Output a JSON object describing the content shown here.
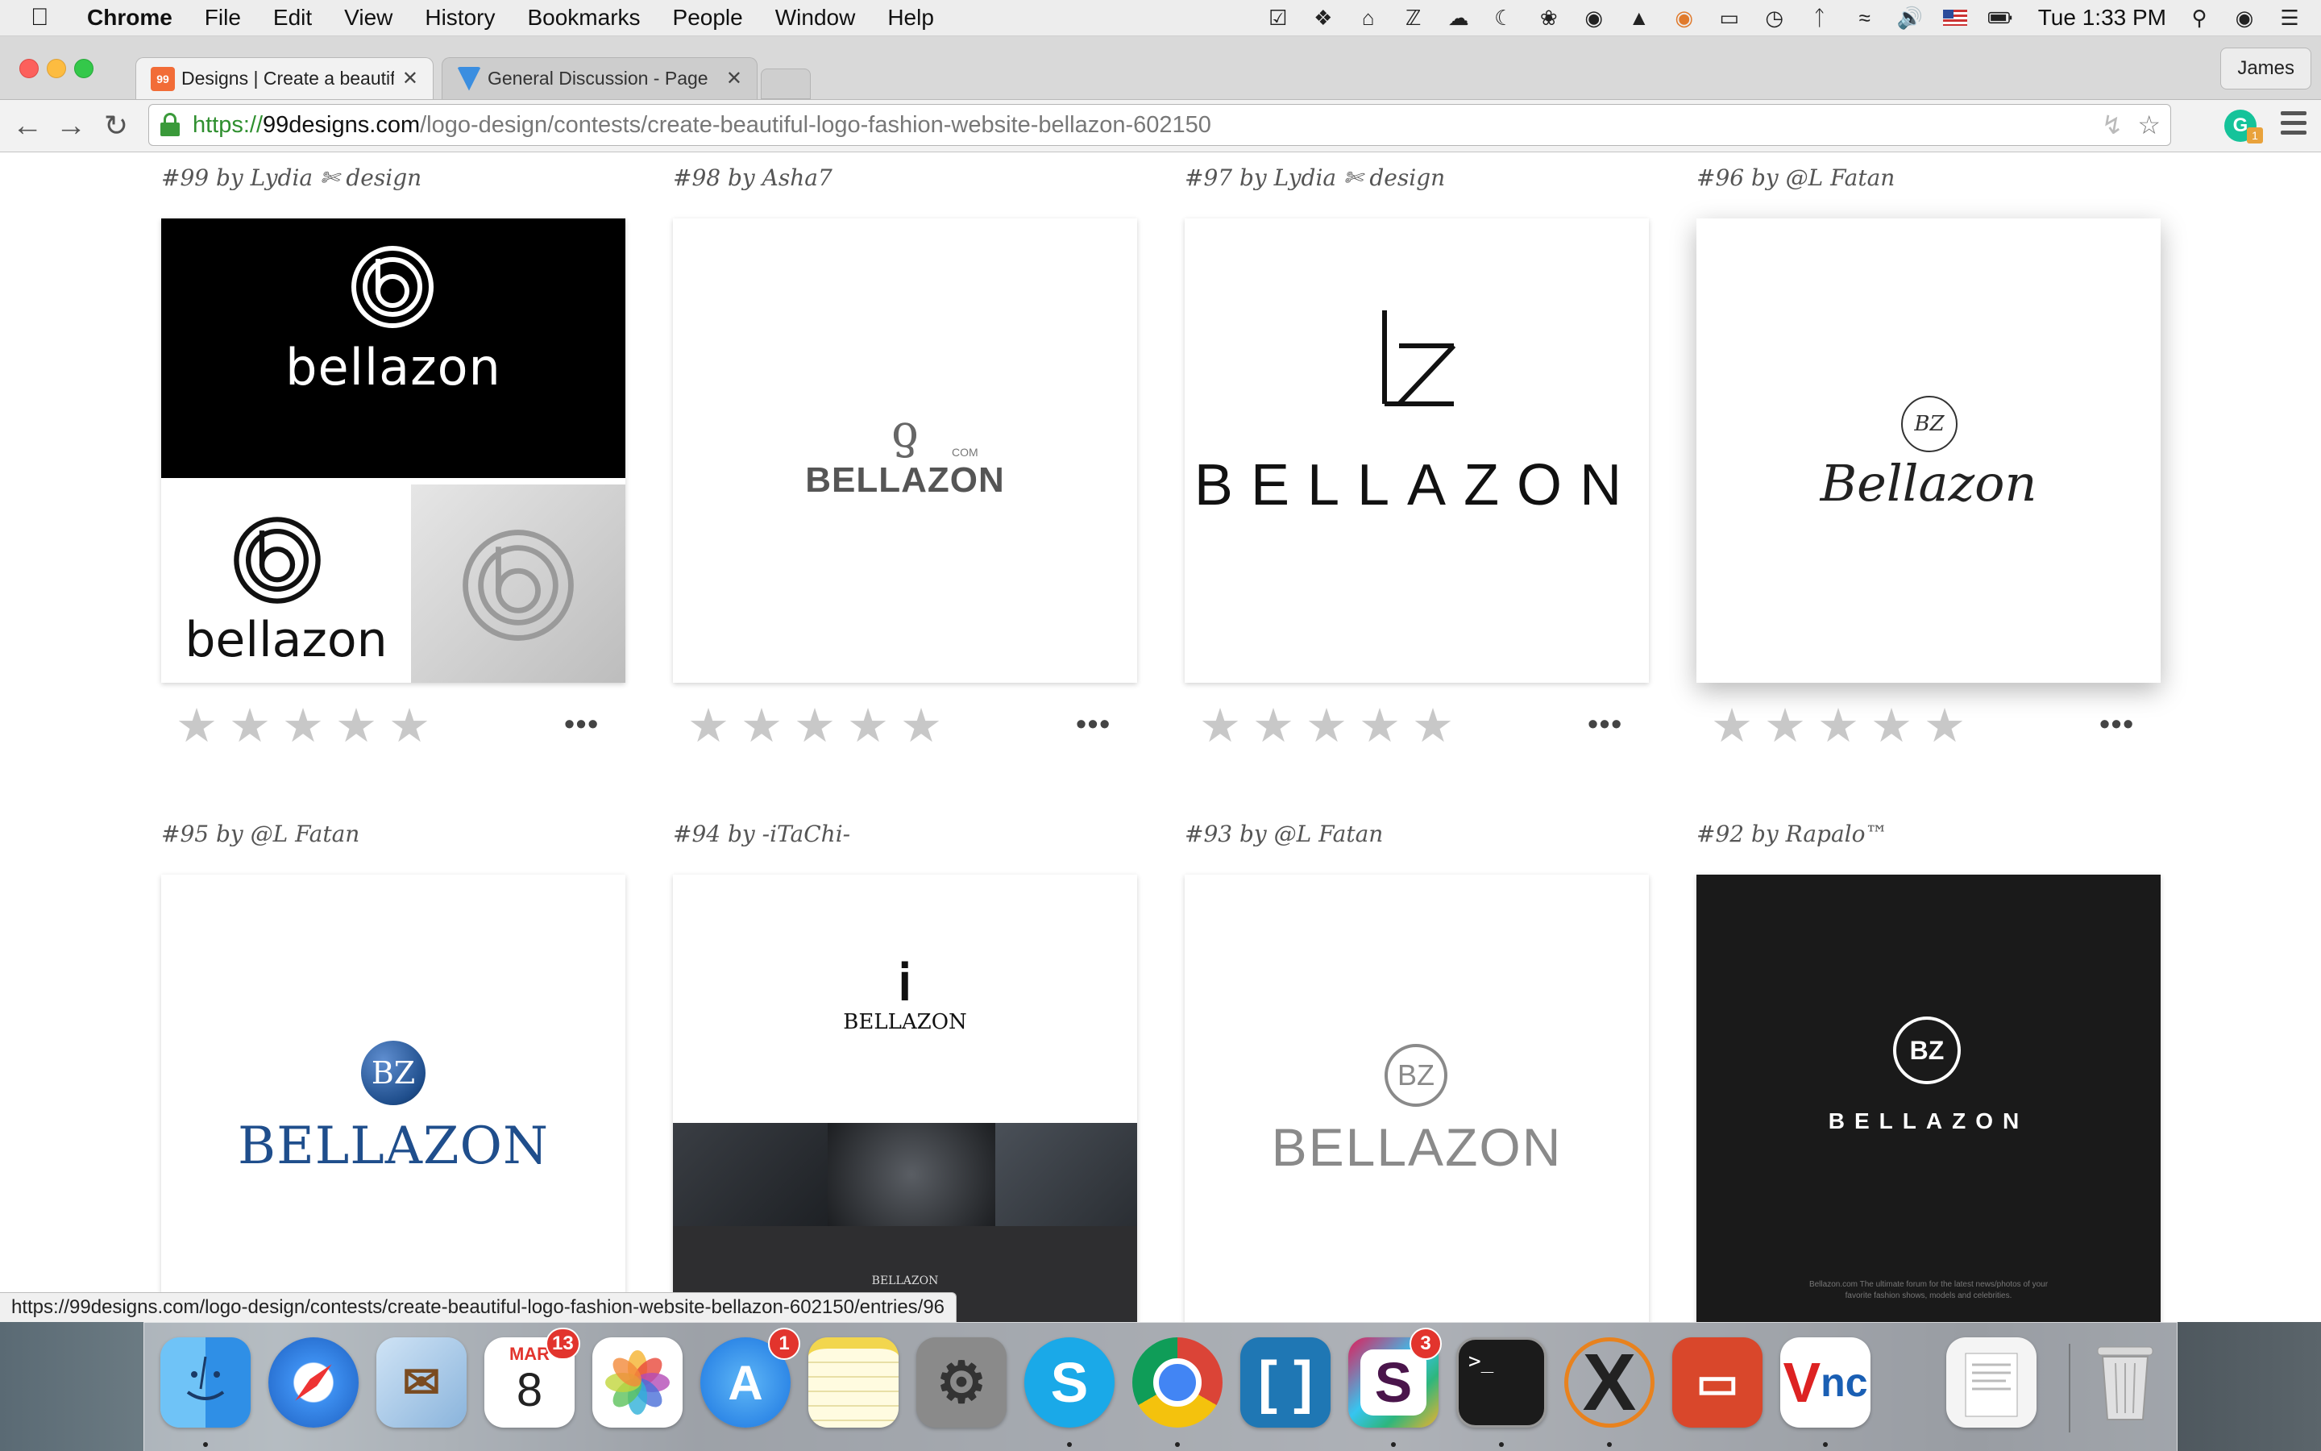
{
  "menubar": {
    "app": "Chrome",
    "items": [
      "File",
      "Edit",
      "View",
      "History",
      "Bookmarks",
      "People",
      "Window",
      "Help"
    ],
    "clock": "Tue 1:33 PM"
  },
  "tabs": [
    {
      "title": "Designs | Create a beautiful",
      "favicon": "99"
    },
    {
      "title": "General Discussion - Page"
    }
  ],
  "profile": "James",
  "address": {
    "scheme": "https://",
    "host": "99designs.com",
    "path": "/logo-design/contests/create-beautiful-logo-fashion-website-bellazon-602150"
  },
  "entries": [
    {
      "label": "#99 by Lydia ✄ design",
      "logo": "bellazon",
      "sub": "bellazon"
    },
    {
      "label": "#98 by Asha7",
      "logo": "BELLAZON",
      "sub": "COM"
    },
    {
      "label": "#97 by Lydia ✄ design",
      "logo": "BELLAZON",
      "sub": ""
    },
    {
      "label": "#96 by @L Fatan",
      "logo": "Bellazon",
      "sub": "BZ"
    },
    {
      "label": "#95 by @L Fatan",
      "logo": "BELLAZON",
      "sub": "BZ"
    },
    {
      "label": "#94 by -iTaChi-",
      "logo": "BELLAZON",
      "sub": "BELLAZON"
    },
    {
      "label": "#93 by @L Fatan",
      "logo": "BELLAZON",
      "sub": "BZ"
    },
    {
      "label": "#92 by Rapalo™",
      "logo": "BELLAZON",
      "sub": "BZ",
      "fine_print": "Bellazon.com The ultimate forum for the latest news/photos of your favorite fashion shows, models and celebrities."
    }
  ],
  "status_url": "https://99designs.com/logo-design/contests/create-beautiful-logo-fashion-website-bellazon-602150/entries/96",
  "dock": {
    "calendar_month": "MAR",
    "calendar_day": "8",
    "badges": {
      "calendar": "13",
      "appstore": "1",
      "slack": "3"
    },
    "terminal_prompt": ">_"
  },
  "colors": {
    "page_bg": "#ffffff",
    "star": "#c8c8c8",
    "url_green": "#2f8f2f",
    "bz_blue": "#1f4e8c"
  }
}
